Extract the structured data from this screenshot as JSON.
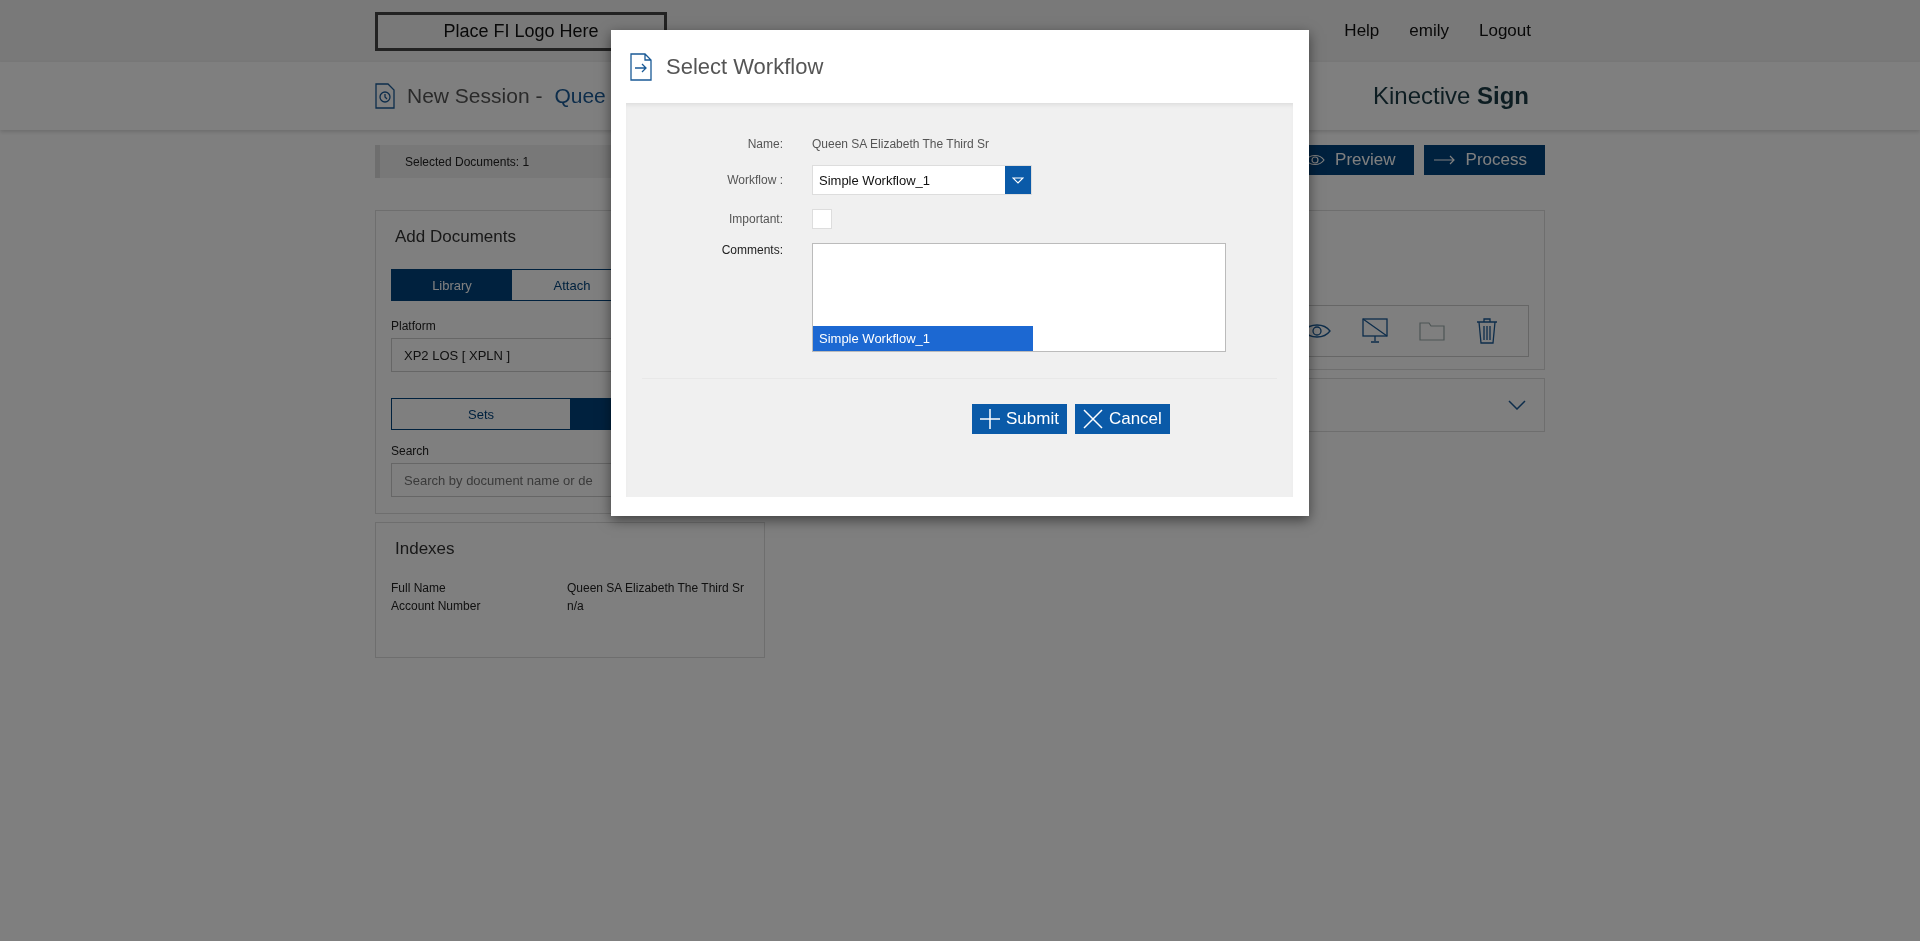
{
  "header": {
    "logo_text": "Place FI Logo Here",
    "nav": [
      {
        "label": "Help"
      },
      {
        "label": "emily"
      },
      {
        "label": "Logout"
      }
    ]
  },
  "subheader": {
    "title": "New Session -",
    "session_name": "Quee",
    "brand": "Kinective **Sign**"
  },
  "toolbar": {
    "selected_documents": "Selected Documents: 1",
    "buttons": [
      {
        "label": "Preview",
        "kind": "preview"
      },
      {
        "label": "Process",
        "kind": "process"
      }
    ]
  },
  "add_documents": {
    "title": "Add Documents",
    "source_tabs": [
      {
        "label": "Library",
        "selected": true
      },
      {
        "label": "Attach",
        "selected": false
      }
    ],
    "platform_label": "Platform",
    "platform_value": "XP2 LOS [ XPLN ]",
    "type_tabs": [
      {
        "label": "Sets",
        "selected": false
      },
      {
        "selected": true
      }
    ],
    "search_label": "Search",
    "search_placeholder": "Search by document name or de"
  },
  "indexes": {
    "title": "Indexes",
    "rows": [
      {
        "label": "Full Name",
        "value": "Queen SA Elizabeth The Third Sr"
      },
      {
        "label": "Account Number",
        "value": "n/a"
      }
    ]
  },
  "modal": {
    "title": "Select Workflow",
    "name_label": "Name:",
    "name_value": "Queen SA Elizabeth The Third Sr",
    "workflow_label": "Workflow :",
    "workflow_value": "Simple Workflow_1",
    "important_label": "Important:",
    "important_checked": false,
    "comments_label": "Comments:",
    "dropdown_options": [
      {
        "label": "Simple Workflow_1",
        "selected": true
      }
    ],
    "buttons": [
      {
        "label": "Submit",
        "kind": "submit"
      },
      {
        "label": "Cancel",
        "kind": "cancel"
      }
    ]
  }
}
